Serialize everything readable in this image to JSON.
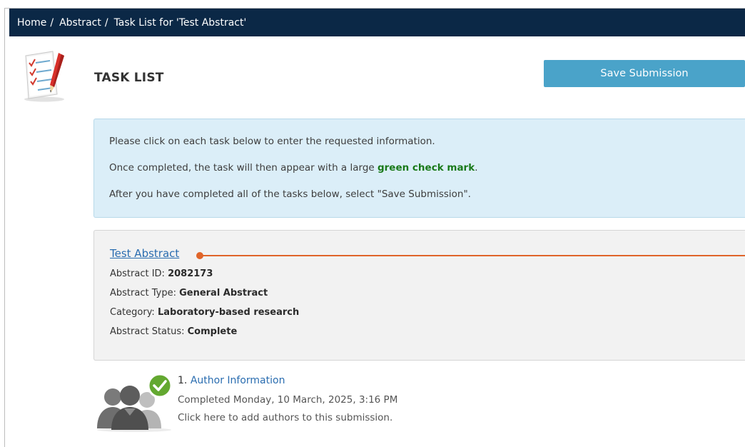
{
  "breadcrumb": {
    "items": [
      "Home",
      "Abstract",
      "Task List for 'Test Abstract'"
    ],
    "separator": "/"
  },
  "page": {
    "title": "TASK LIST",
    "save_button_label": "Save Submission"
  },
  "instructions": {
    "line1": "Please click on each task below to enter the requested information.",
    "line2_prefix": "Once completed, the task will then appear with a large ",
    "line2_highlight": "green check mark",
    "line2_suffix": ".",
    "line3": "After you have completed all of the tasks below, select \"Save Submission\"."
  },
  "abstract": {
    "title": "Test Abstract",
    "fields": [
      {
        "label": "Abstract ID: ",
        "value": "2082173"
      },
      {
        "label": "Abstract Type: ",
        "value": "General Abstract"
      },
      {
        "label": "Category: ",
        "value": "Laboratory-based research"
      },
      {
        "label": "Abstract Status: ",
        "value": "Complete"
      }
    ]
  },
  "tasks": [
    {
      "number": "1. ",
      "name": "Author Information",
      "status": "Completed Monday, 10 March, 2025, 3:16 PM",
      "description": "Click here to add authors to this submission."
    }
  ],
  "colors": {
    "breadcrumb_bg": "#0b2846",
    "save_button": "#4aa3c9",
    "info_bg": "#dbeef8",
    "card_bg": "#f2f2f2",
    "link": "#2a6db0",
    "highlight_green": "#1a7a1a",
    "marker": "#e0652a",
    "check_badge": "#63a830"
  },
  "icons": {
    "task_list": "checklist-pencil-icon",
    "task_author": "people-group-icon",
    "task_status": "check-circle-icon"
  }
}
